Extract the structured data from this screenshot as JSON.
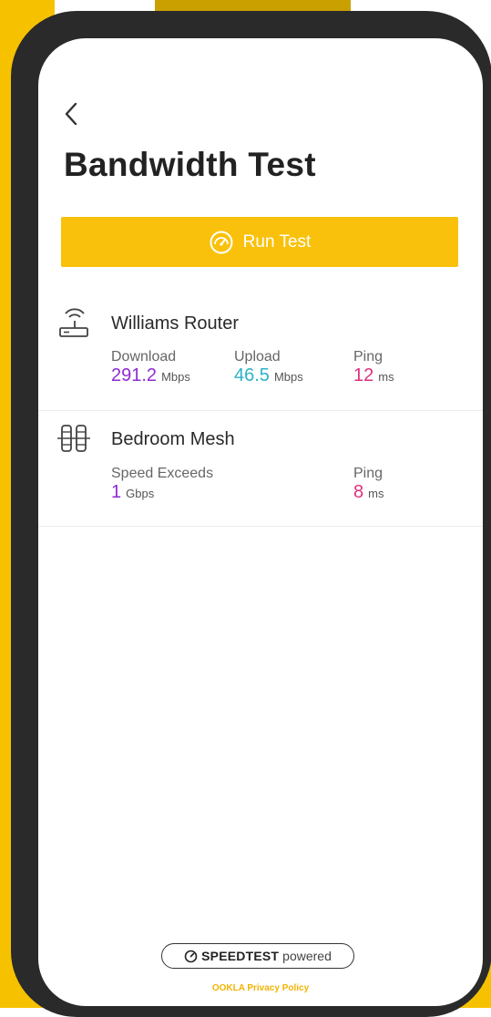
{
  "header": {
    "back_icon": "chevron-left-icon",
    "title": "Bandwidth Test"
  },
  "run_test": {
    "icon": "speedometer-icon",
    "label": "Run Test"
  },
  "devices": [
    {
      "icon": "router-icon",
      "name": "Williams Router",
      "metrics": [
        {
          "label": "Download",
          "value": "291.2",
          "unit": "Mbps",
          "color": "#8e2bd6"
        },
        {
          "label": "Upload",
          "value": "46.5",
          "unit": "Mbps",
          "color": "#2bb3c6"
        },
        {
          "label": "Ping",
          "value": "12",
          "unit": "ms",
          "color": "#e0307e"
        }
      ]
    },
    {
      "icon": "mesh-icon",
      "name": "Bedroom Mesh",
      "metrics": [
        {
          "label": "Speed Exceeds",
          "value": "1",
          "unit": "Gbps",
          "color": "#8e2bd6"
        },
        {
          "label": "Ping",
          "value": "8",
          "unit": "ms",
          "color": "#e0307e"
        }
      ]
    }
  ],
  "footer": {
    "speedtest_brand": "SPEEDTEST",
    "speedtest_powered": "powered",
    "privacy_link": "OOKLA Privacy Policy"
  },
  "colors": {
    "accent": "#f9c10b",
    "background_accent": "#f6c200",
    "phone_frame": "#2a2a2a"
  }
}
